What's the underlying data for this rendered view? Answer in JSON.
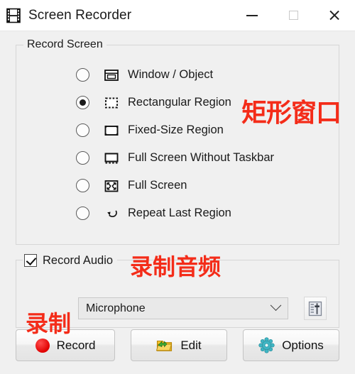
{
  "window": {
    "title": "Screen Recorder",
    "icon": "film-strip-icon",
    "controls": {
      "minimize": "minimize-button",
      "maximize": "maximize-button",
      "close": "close-button"
    }
  },
  "record_screen_group": {
    "legend": "Record Screen",
    "options": [
      {
        "label": "Window / Object",
        "icon": "window-icon",
        "selected": false
      },
      {
        "label": "Rectangular Region",
        "icon": "dashed-rect-icon",
        "selected": true
      },
      {
        "label": "Fixed-Size Region",
        "icon": "fixed-rect-icon",
        "selected": false
      },
      {
        "label": "Full Screen Without Taskbar",
        "icon": "screen-no-taskbar-icon",
        "selected": false
      },
      {
        "label": "Full Screen",
        "icon": "fullscreen-icon",
        "selected": false
      },
      {
        "label": "Repeat Last Region",
        "icon": "repeat-arrow-icon",
        "selected": false
      }
    ]
  },
  "record_audio_group": {
    "checkbox_label": "Record Audio",
    "checked": true,
    "device_select": {
      "value": "Microphone",
      "options": [
        "Microphone"
      ]
    },
    "aux_button_icon": "audio-mixer-icon"
  },
  "buttons": {
    "record": {
      "label": "Record",
      "icon": "red-record-dot-icon"
    },
    "edit": {
      "label": "Edit",
      "icon": "folder-open-icon"
    },
    "options": {
      "label": "Options",
      "icon": "gear-icon"
    }
  },
  "annotations": [
    {
      "text": "矩形窗口",
      "refers_to": "Rectangular Region"
    },
    {
      "text": "录制音频",
      "refers_to": "Record Audio"
    },
    {
      "text": "录制",
      "refers_to": "Record"
    }
  ],
  "colors": {
    "window_background": "#f0f0f0",
    "titlebar_background": "#ffffff",
    "annotation_red": "#f42c19",
    "record_dot_red": "#e00000",
    "edit_icon_yellow": "#f5c518",
    "edit_icon_green": "#3fae35",
    "options_icon_teal": "#3fb6c4"
  }
}
